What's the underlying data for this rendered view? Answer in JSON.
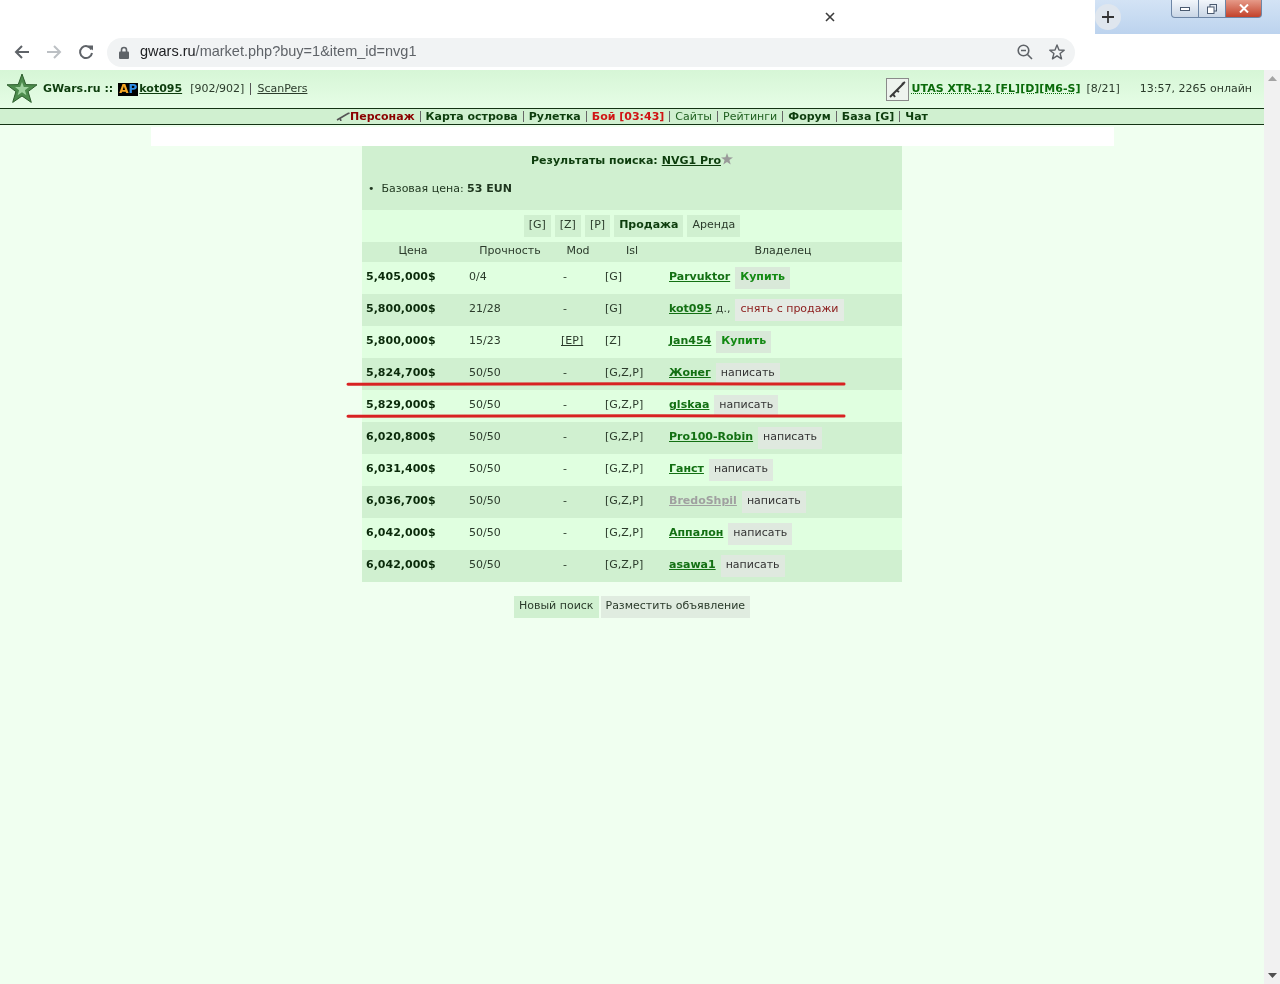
{
  "browser": {
    "address": {
      "host": "gwars.ru",
      "path": "/market.php?buy=1&item_id=nvg1"
    }
  },
  "header": {
    "site": "GWars.ru ::",
    "user_badge": [
      "A",
      "P"
    ],
    "user": "kot095",
    "hp": "[902/902]",
    "scan": "ScanPers",
    "weapon": "UTAS XTR-12 [FL][D][M6-S]",
    "weapon_count": "[8/21]",
    "status": "13:57, 2265 онлайн"
  },
  "nav": [
    {
      "label": "Персонаж",
      "kind": "current"
    },
    {
      "label": "Карта острова",
      "kind": "bold"
    },
    {
      "label": "Рулетка",
      "kind": "bold"
    },
    {
      "label": "Бой [03:43]",
      "kind": "alert"
    },
    {
      "label": "Сайты",
      "kind": "plain"
    },
    {
      "label": "Рейтинги",
      "kind": "plain"
    },
    {
      "label": "Форум",
      "kind": "bold"
    },
    {
      "label": "База [G]",
      "kind": "bold"
    },
    {
      "label": "Чат",
      "kind": "bold"
    }
  ],
  "search": {
    "title": "Результаты поиска:",
    "item": "NVG1 Pro",
    "bullet": "•",
    "base_price": "Базовая цена: **53 EUN**"
  },
  "filters": [
    {
      "label": "[G]",
      "selected": false
    },
    {
      "label": "[Z]",
      "selected": false
    },
    {
      "label": "[P]",
      "selected": false
    },
    {
      "label": "Продажа",
      "selected": true
    },
    {
      "label": "Аренда",
      "selected": false
    }
  ],
  "table": {
    "columns": [
      "Цена",
      "Прочность",
      "Mod",
      "Isl",
      "Владелец"
    ],
    "rows": [
      {
        "price": "5,405,000$",
        "durability": "0/4",
        "mod": "-",
        "mod_link": false,
        "island": "[G]",
        "owner": "Parvuktor",
        "offline": false,
        "action": {
          "kind": "buy",
          "label": "Купить"
        },
        "underlined": false
      },
      {
        "price": "5,800,000$",
        "durability": "21/28",
        "mod": "-",
        "mod_link": false,
        "island": "[G]",
        "owner": "kot095",
        "offline": false,
        "note": "д.,",
        "action": {
          "kind": "remove",
          "label": "снять с продажи"
        },
        "underlined": false
      },
      {
        "price": "5,800,000$",
        "durability": "15/23",
        "mod": "[EP]",
        "mod_link": true,
        "island": "[Z]",
        "owner": "Jan454",
        "offline": false,
        "action": {
          "kind": "buy",
          "label": "Купить"
        },
        "underlined": false
      },
      {
        "price": "5,824,700$",
        "durability": "50/50",
        "mod": "-",
        "mod_link": false,
        "island": "[G,Z,P]",
        "owner": "Жонег",
        "offline": false,
        "action": {
          "kind": "message",
          "label": "написать"
        },
        "underlined": true
      },
      {
        "price": "5,829,000$",
        "durability": "50/50",
        "mod": "-",
        "mod_link": false,
        "island": "[G,Z,P]",
        "owner": "glskaa",
        "offline": false,
        "action": {
          "kind": "message",
          "label": "написать"
        },
        "underlined": true
      },
      {
        "price": "6,020,800$",
        "durability": "50/50",
        "mod": "-",
        "mod_link": false,
        "island": "[G,Z,P]",
        "owner": "Pro100-Robin",
        "offline": false,
        "action": {
          "kind": "message",
          "label": "написать"
        },
        "underlined": false
      },
      {
        "price": "6,031,400$",
        "durability": "50/50",
        "mod": "-",
        "mod_link": false,
        "island": "[G,Z,P]",
        "owner": "Ганст",
        "offline": false,
        "action": {
          "kind": "message",
          "label": "написать"
        },
        "underlined": false
      },
      {
        "price": "6,036,700$",
        "durability": "50/50",
        "mod": "-",
        "mod_link": false,
        "island": "[G,Z,P]",
        "owner": "BredoShpil",
        "offline": true,
        "action": {
          "kind": "message",
          "label": "написать"
        },
        "underlined": false
      },
      {
        "price": "6,042,000$",
        "durability": "50/50",
        "mod": "-",
        "mod_link": false,
        "island": "[G,Z,P]",
        "owner": "Аппалон",
        "offline": false,
        "action": {
          "kind": "message",
          "label": "написать"
        },
        "underlined": false
      },
      {
        "price": "6,042,000$",
        "durability": "50/50",
        "mod": "-",
        "mod_link": false,
        "island": "[G,Z,P]",
        "owner": "asawa1",
        "offline": false,
        "action": {
          "kind": "message",
          "label": "написать"
        },
        "underlined": false
      }
    ]
  },
  "buttons": [
    {
      "label": "Новый поиск",
      "kind": "primary"
    },
    {
      "label": "Разместить объявление",
      "kind": "secondary"
    }
  ]
}
